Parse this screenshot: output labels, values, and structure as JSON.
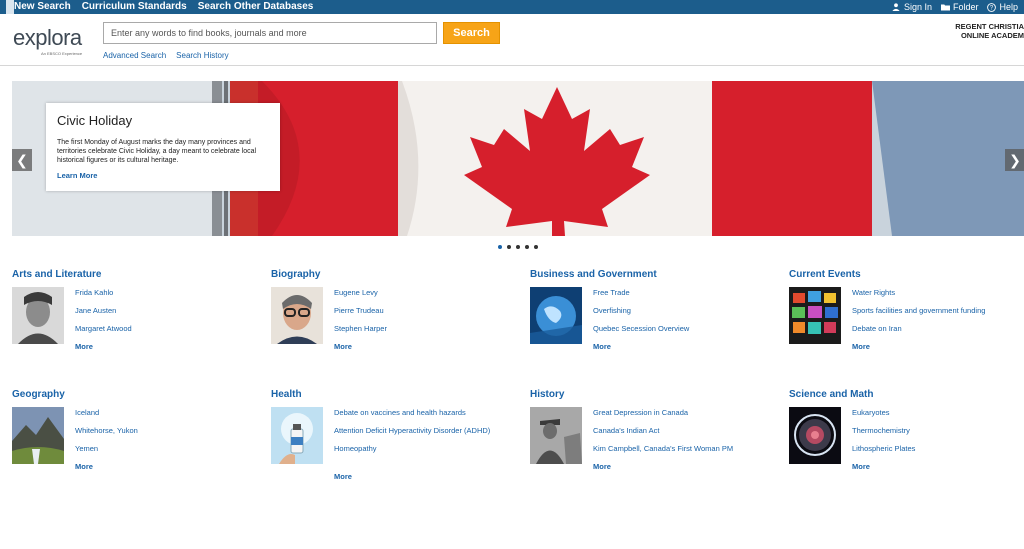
{
  "topnav": {
    "new_search": "New Search",
    "curriculum": "Curriculum Standards",
    "other_db": "Search Other Databases"
  },
  "utility": {
    "sign_in": "Sign In",
    "folder": "Folder",
    "help": "Help"
  },
  "header": {
    "logo_text": "explora",
    "logo_sub": "An EBSCO Experience",
    "search_placeholder": "Enter any words to find books, journals and more",
    "search_button": "Search",
    "advanced_search": "Advanced Search",
    "search_history": "Search History",
    "institution_line1": "REGENT CHRISTIA",
    "institution_line2": "ONLINE ACADEM"
  },
  "hero": {
    "title": "Civic Holiday",
    "body": "The first Monday of August marks the day many provinces and territories celebrate Civic Holiday, a day meant to celebrate local historical figures or its cultural heritage.",
    "link": "Learn More",
    "prev": "❮",
    "next": "❯",
    "slide_count": 5,
    "active_slide": 1
  },
  "categories": [
    {
      "title": "Arts and Literature",
      "links": [
        "Frida Kahlo",
        "Jane Austen",
        "Margaret Atwood"
      ],
      "more": "More"
    },
    {
      "title": "Biography",
      "links": [
        "Eugene Levy",
        "Pierre Trudeau",
        "Stephen Harper"
      ],
      "more": "More"
    },
    {
      "title": "Business and Government",
      "links": [
        "Free Trade",
        "Overfishing",
        "Quebec Secession Overview"
      ],
      "more": "More"
    },
    {
      "title": "Current Events",
      "links": [
        "Water Rights",
        "Sports facilities and government funding",
        "Debate on Iran"
      ],
      "more": "More"
    },
    {
      "title": "Geography",
      "links": [
        "Iceland",
        "Whitehorse, Yukon",
        "Yemen"
      ],
      "more": "More"
    },
    {
      "title": "Health",
      "links": [
        "Debate on vaccines and health hazards",
        "Attention Deficit Hyperactivity Disorder (ADHD)",
        "Homeopathy"
      ],
      "more": "More"
    },
    {
      "title": "History",
      "links": [
        "Great Depression in Canada",
        "Canada's Indian Act",
        "Kim Campbell, Canada's First Woman PM"
      ],
      "more": "More"
    },
    {
      "title": "Science and Math",
      "links": [
        "Eukaryotes",
        "Thermochemistry",
        "Lithospheric Plates"
      ],
      "more": "More"
    }
  ],
  "colors": {
    "topbar": "#1c5d8c",
    "link": "#1a63a8",
    "search_button": "#f7a417",
    "flag_red": "#d61f2c"
  }
}
